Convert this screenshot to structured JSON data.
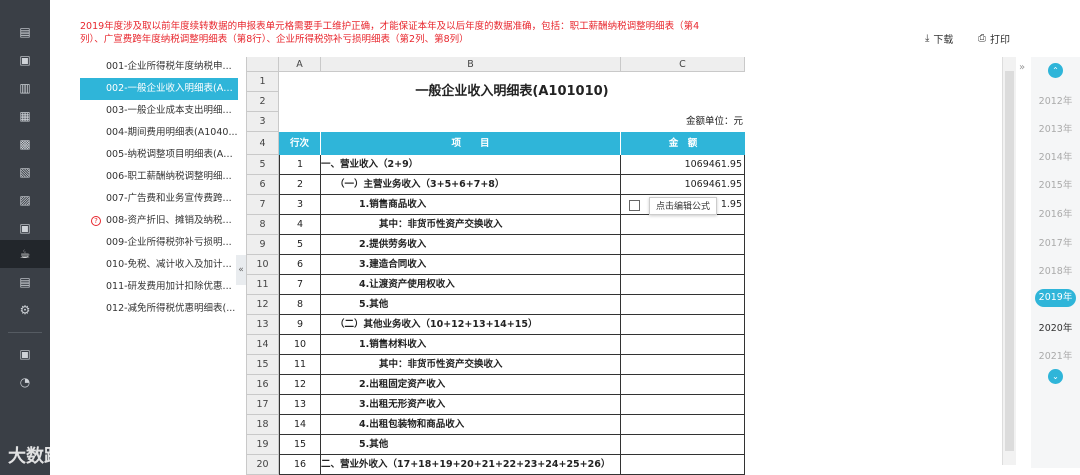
{
  "notice": "2019年度涉及取以前年度续转数据的申报表单元格需要手工维护正确，才能保证本年及以后年度的数据准确，包括：职工薪酬纳税调整明细表（第4列）、广宣费跨年度纳税调整明细表（第8行）、企业所得税弥补亏损明细表（第2列、第8列）",
  "toolbar": {
    "download": "下载",
    "print": "打印"
  },
  "tree": [
    "001-企业所得税年度纳税申...",
    "002-一般企业收入明细表(A1...",
    "003-一般企业成本支出明细...",
    "004-期间费用明细表(A1040...",
    "005-纳税调整项目明细表(A1...",
    "006-职工薪酬纳税调整明细...",
    "007-广告费和业务宣传费跨...",
    "008-资产折旧、摊销及纳税...",
    "009-企业所得税弥补亏损明...",
    "010-免税、减计收入及加计...",
    "011-研发费用加计扣除优惠...",
    "012-减免所得税优惠明细表(..."
  ],
  "columns": [
    "A",
    "B",
    "C"
  ],
  "rownums": [
    "1",
    "2",
    "3",
    "4",
    "5",
    "6",
    "7",
    "8",
    "9",
    "10",
    "11",
    "12",
    "13",
    "14",
    "15",
    "16",
    "17",
    "18",
    "19",
    "20"
  ],
  "sheet": {
    "title": "一般企业收入明细表(A101010)",
    "unit": "金额单位：元",
    "h_seq": "行次",
    "h_item": "项　　目",
    "h_amt": "金　额",
    "rows": [
      {
        "seq": "1",
        "item": "一、营业收入（2+9）",
        "amt": "1069461.95"
      },
      {
        "seq": "2",
        "item": "（一）主营业务收入（3+5+6+7+8）",
        "amt": "1069461.95"
      },
      {
        "seq": "3",
        "item": "1.销售商品收入",
        "amt": "1.95"
      },
      {
        "seq": "4",
        "item": "其中：非货币性资产交换收入",
        "amt": ""
      },
      {
        "seq": "5",
        "item": "2.提供劳务收入",
        "amt": ""
      },
      {
        "seq": "6",
        "item": "3.建造合同收入",
        "amt": ""
      },
      {
        "seq": "7",
        "item": "4.让渡资产使用权收入",
        "amt": ""
      },
      {
        "seq": "8",
        "item": "5.其他",
        "amt": ""
      },
      {
        "seq": "9",
        "item": "（二）其他业务收入（10+12+13+14+15）",
        "amt": ""
      },
      {
        "seq": "10",
        "item": "1.销售材料收入",
        "amt": ""
      },
      {
        "seq": "11",
        "item": "其中：非货币性资产交换收入",
        "amt": ""
      },
      {
        "seq": "12",
        "item": "2.出租固定资产收入",
        "amt": ""
      },
      {
        "seq": "13",
        "item": "3.出租无形资产收入",
        "amt": ""
      },
      {
        "seq": "14",
        "item": "4.出租包装物和商品收入",
        "amt": ""
      },
      {
        "seq": "15",
        "item": "5.其他",
        "amt": ""
      },
      {
        "seq": "16",
        "item": "二、营业外收入（17+18+19+20+21+22+23+24+25+26）",
        "amt": ""
      }
    ]
  },
  "popup": "点击编辑公式",
  "years": [
    "2012年",
    "2013年",
    "2014年",
    "2015年",
    "2016年",
    "2017年",
    "2018年",
    "2019年",
    "2020年",
    "2021年"
  ],
  "selected_year": "2019年",
  "colors": {
    "accent": "#2fb5d9",
    "rail": "#3a3f46",
    "notice": "#e8262d"
  },
  "watermark": "大数跨境"
}
